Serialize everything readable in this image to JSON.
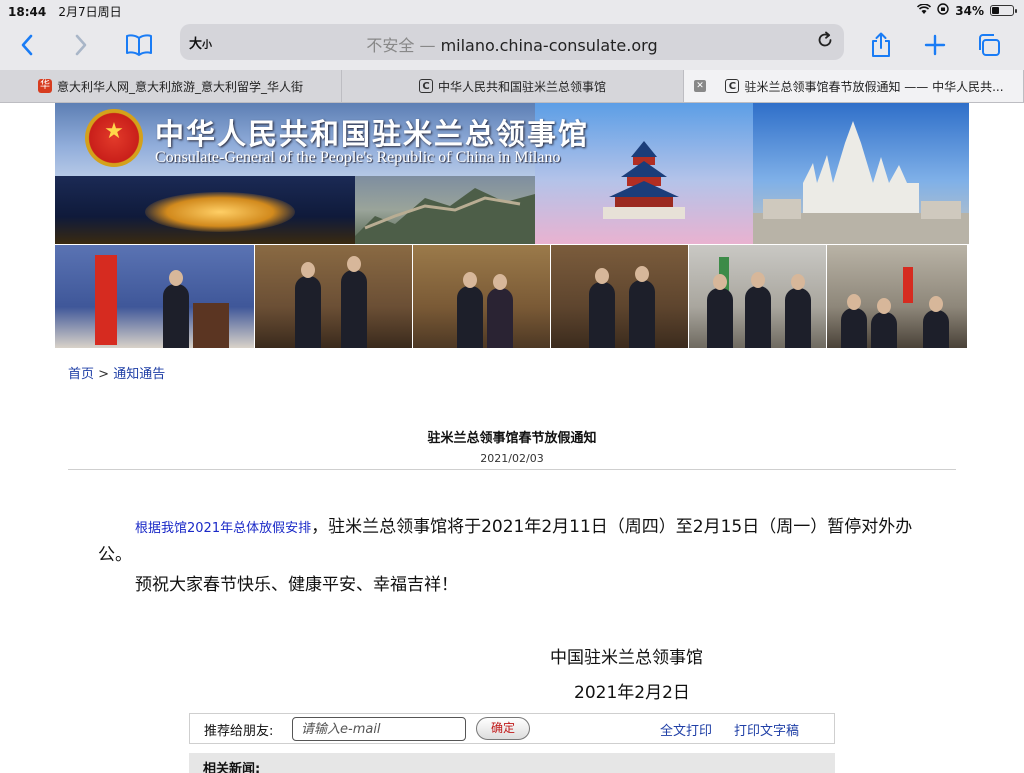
{
  "status": {
    "time": "18:44",
    "date": "2月7日周日",
    "battery_text": "34%",
    "battery_level": 0.34
  },
  "toolbar": {
    "text_size_label": "大",
    "text_size_small": "小",
    "url_insecure": "不安全 —",
    "url_host": "milano.china-consulate.org"
  },
  "tabs": [
    {
      "label": "意大利华人网_意大利旅游_意大利留学_华人街",
      "fav": "华"
    },
    {
      "label": "中华人民共和国驻米兰总领事馆",
      "fav": "C"
    },
    {
      "label": "驻米兰总领事馆春节放假通知 —— 中华人民共...",
      "fav": "C",
      "close": "✕"
    }
  ],
  "banner": {
    "title_cn": "中华人民共和国驻米兰总领事馆",
    "title_en": "Consulate-General of the People's Republic of China in Milano"
  },
  "breadcrumb": {
    "home": "首页",
    "sep": " > ",
    "section": "通知通告"
  },
  "article": {
    "title": "驻米兰总领事馆春节放假通知",
    "date": "2021/02/03",
    "p1_link": "根据我馆2021年总体放假安排",
    "p1_text": "，驻米兰总领事馆将于2021年2月11日（周四）至2月15日（周一）暂停对外办公。",
    "p2_text": "预祝大家春节快乐、健康平安、幸福吉祥！",
    "signature": "中国驻米兰总领事馆",
    "sign_date": "2021年2月2日"
  },
  "share": {
    "label": "推荐给朋友:",
    "placeholder": "请输入e-mail",
    "ok_label": "确定",
    "print_full": "全文打印",
    "print_text": "打印文字稿"
  },
  "related": {
    "label": "相关新闻:"
  },
  "colors": {
    "accent": "#1a7cf5",
    "link": "#1f3fa6",
    "button_text": "#c01818"
  }
}
